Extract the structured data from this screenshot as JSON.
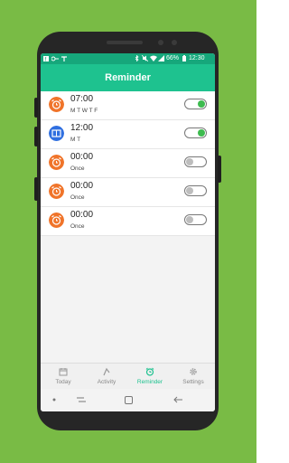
{
  "status": {
    "left_icons": [
      "facebook-icon",
      "key-icon",
      "tools-icon"
    ],
    "battery": "66%",
    "time": "12:30"
  },
  "app": {
    "title": "Reminder"
  },
  "reminders": [
    {
      "time": "07:00",
      "days": "M T W T F",
      "icon": "alarm-icon",
      "icon_color": "#f0742a",
      "enabled": true
    },
    {
      "time": "12:00",
      "days": "M T",
      "icon": "book-icon",
      "icon_color": "#2f6fe0",
      "enabled": true
    },
    {
      "time": "00:00",
      "days": "Once",
      "icon": "alarm-icon",
      "icon_color": "#f0742a",
      "enabled": false
    },
    {
      "time": "00:00",
      "days": "Once",
      "icon": "alarm-icon",
      "icon_color": "#f0742a",
      "enabled": false
    },
    {
      "time": "00:00",
      "days": "Once",
      "icon": "alarm-icon",
      "icon_color": "#f0742a",
      "enabled": false
    }
  ],
  "bottom_nav": [
    {
      "label": "Today",
      "icon": "calendar-icon",
      "active": false
    },
    {
      "label": "Activity",
      "icon": "activity-icon",
      "active": false
    },
    {
      "label": "Reminder",
      "icon": "alarm-icon",
      "active": true
    },
    {
      "label": "Settings",
      "icon": "gear-icon",
      "active": false
    }
  ],
  "colors": {
    "background": "#79bb45",
    "accent": "#1ec28f",
    "statusbar": "#16a77b",
    "toggle_on": "#3dbb4f"
  }
}
